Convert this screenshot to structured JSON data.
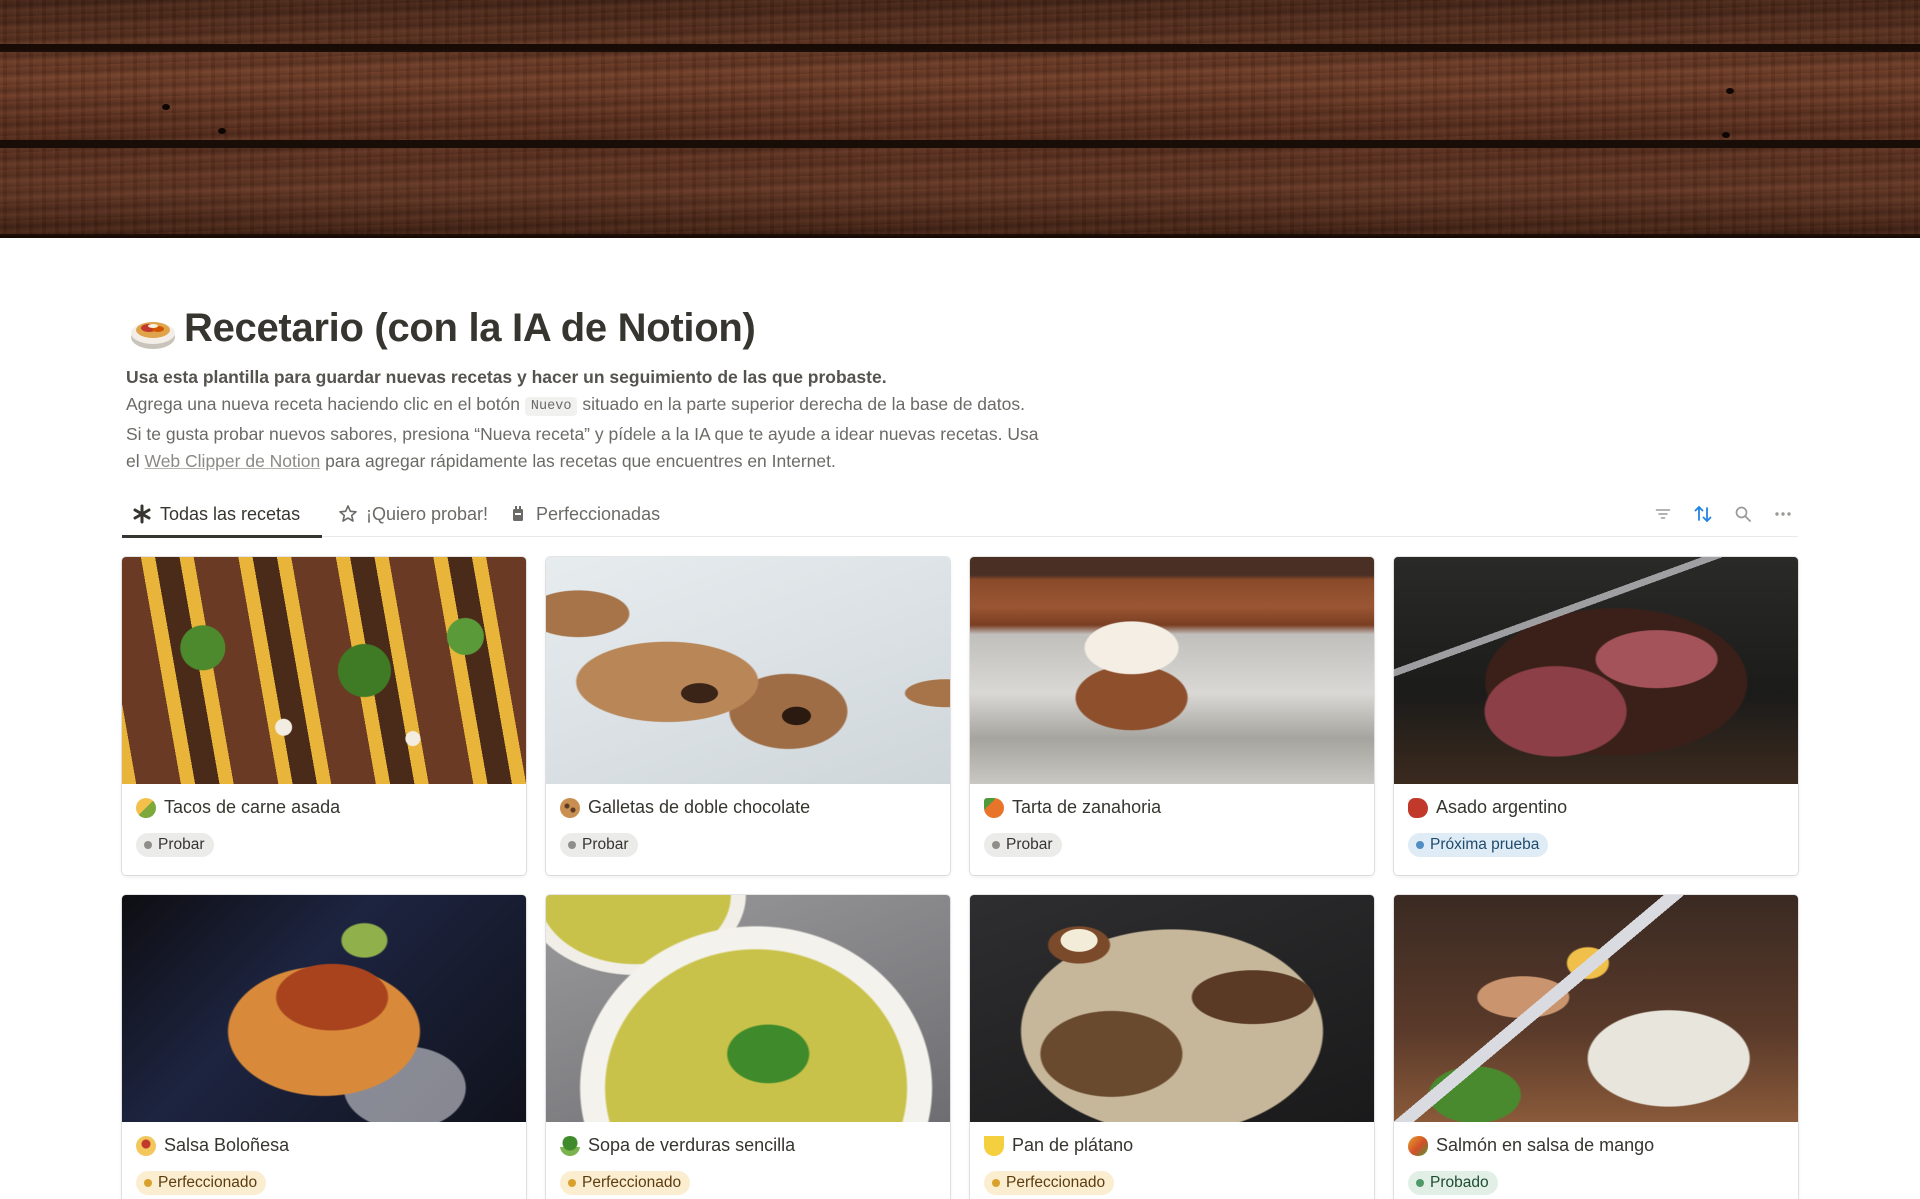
{
  "page": {
    "title": "Recetario (con la IA de Notion)",
    "icon": "taco-bowl-icon",
    "description": {
      "line1": "Usa esta plantilla para guardar nuevas recetas y hacer un seguimiento de las que probaste.",
      "line2_before": "Agrega una nueva receta haciendo clic en el botón",
      "line2_code": "Nuevo",
      "line2_after": "situado en la parte superior derecha de la base de datos.",
      "line3": "Si te gusta probar nuevos sabores, presiona “Nueva receta” y pídele a la IA que te ayude a idear nuevas recetas. Usa",
      "line4_before": "el",
      "line4_link": "Web Clipper de Notion",
      "line4_after": "para agregar rápidamente las recetas que encuentres en Internet."
    }
  },
  "tabs": [
    {
      "label": "Todas las recetas",
      "icon": "asterisk-icon",
      "active": true
    },
    {
      "label": "¡Quiero probar!",
      "icon": "star-icon",
      "active": false
    },
    {
      "label": "Perfeccionadas",
      "icon": "trophy-icon",
      "active": false
    }
  ],
  "toolbar": {
    "filter_icon": "filter-icon",
    "sort_icon": "sort-icon",
    "search_icon": "search-icon",
    "more_icon": "more-icon",
    "sort_color": "#2383e2"
  },
  "recipes": [
    {
      "name": "Tacos de carne asada",
      "emoji": "taco-icon",
      "status": "Probar",
      "status_color": "gray"
    },
    {
      "name": "Galletas de doble chocolate",
      "emoji": "cookie-icon",
      "status": "Probar",
      "status_color": "gray"
    },
    {
      "name": "Tarta de zanahoria",
      "emoji": "carrot-icon",
      "status": "Probar",
      "status_color": "gray"
    },
    {
      "name": "Asado argentino",
      "emoji": "meat-icon",
      "status": "Próxima prueba",
      "status_color": "blue"
    },
    {
      "name": "Salsa Boloñesa",
      "emoji": "spaghetti-icon",
      "status": "Perfeccionado",
      "status_color": "yellow"
    },
    {
      "name": "Sopa de verduras sencilla",
      "emoji": "broccoli-icon",
      "status": "Perfeccionado",
      "status_color": "yellow"
    },
    {
      "name": "Pan de plátano",
      "emoji": "banana-icon",
      "status": "Perfeccionado",
      "status_color": "yellow"
    },
    {
      "name": "Salmón en salsa de mango",
      "emoji": "mango-icon",
      "status": "Probado",
      "status_color": "green"
    }
  ]
}
